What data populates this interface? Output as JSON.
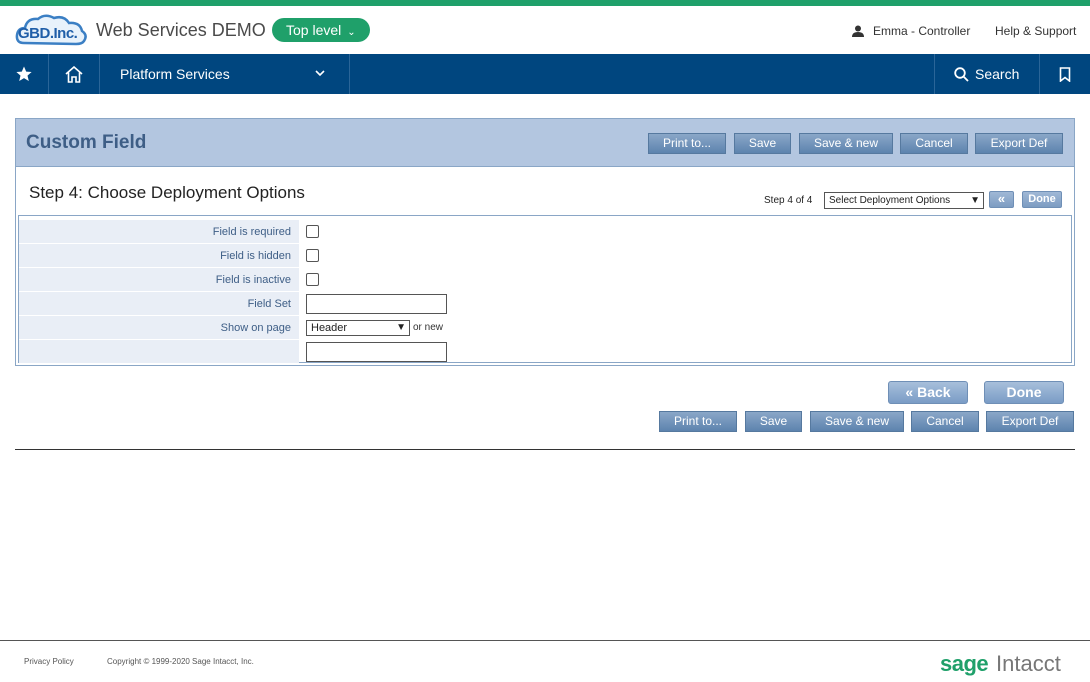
{
  "header": {
    "logo_text": "GBD.Inc.",
    "company": "Web Services DEMO",
    "level": "Top level",
    "user": "Emma - Controller",
    "help": "Help & Support"
  },
  "nav": {
    "platform": "Platform Services",
    "search": "Search"
  },
  "page": {
    "title": "Custom Field",
    "top_buttons": [
      "Print to...",
      "Save",
      "Save & new",
      "Cancel",
      "Export Def"
    ],
    "step_title": "Step 4: Choose Deployment Options",
    "step_info": "Step 4 of 4",
    "step_select": "Select Deployment Options",
    "back_mini": "«",
    "done_mini": "Done"
  },
  "form": {
    "field_required": "Field is required",
    "field_hidden": "Field is hidden",
    "field_inactive": "Field is inactive",
    "field_set": "Field Set",
    "show_on_page": "Show on page",
    "show_on_page_value": "Header",
    "or_new": "or new"
  },
  "actions": {
    "back": "« Back",
    "done": "Done",
    "bottom_buttons": [
      "Print to...",
      "Save",
      "Save & new",
      "Cancel",
      "Export Def"
    ]
  },
  "footer": {
    "privacy": "Privacy Policy",
    "copyright": "Copyright © 1999-2020 Sage Intacct, Inc.",
    "brand_sage": "sage",
    "brand_intacct": "Intacct"
  },
  "colors": {
    "brand_green": "#1fa06a",
    "nav_blue": "#00467f",
    "panel_header": "#b3c6e0"
  }
}
